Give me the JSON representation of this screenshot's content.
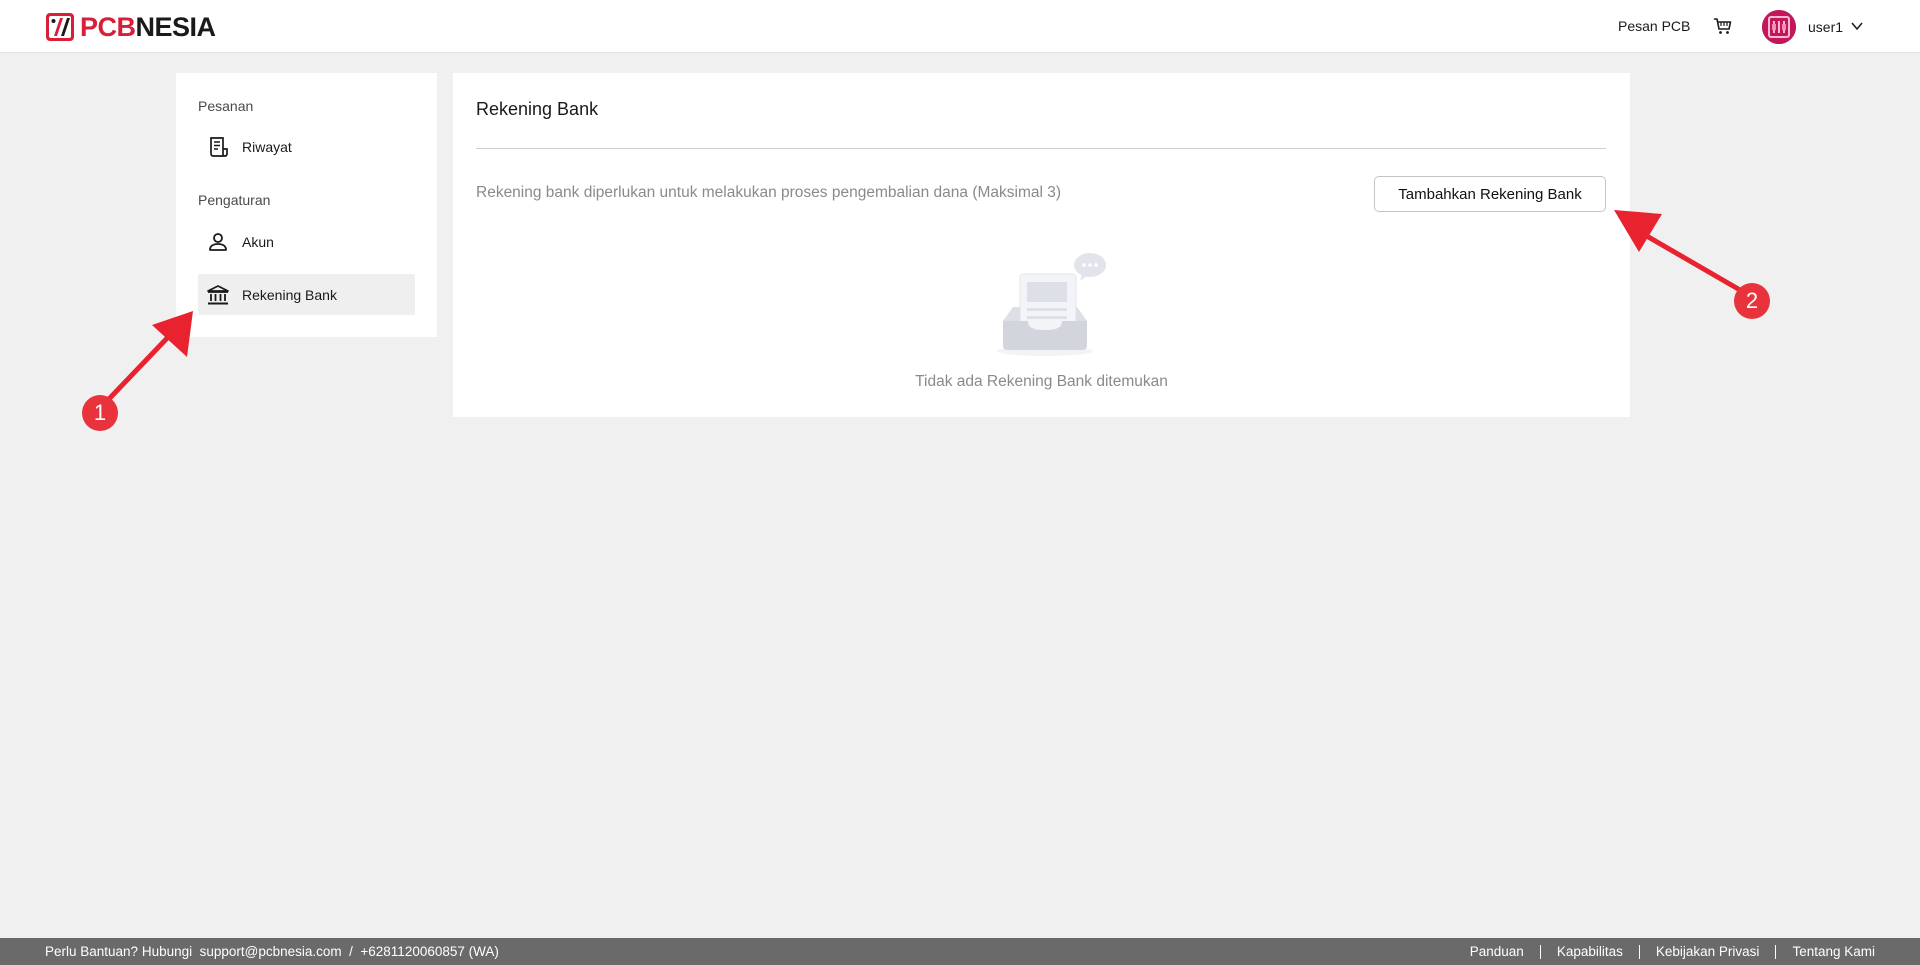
{
  "header": {
    "logo_text_red": "PCB",
    "logo_text_dark": "NESIA",
    "nav_order": "Pesan PCB",
    "user_name": "user1"
  },
  "sidebar": {
    "sections": [
      {
        "label": "Pesanan",
        "items": [
          {
            "label": "Riwayat",
            "icon": "receipt-icon"
          }
        ]
      },
      {
        "label": "Pengaturan",
        "items": [
          {
            "label": "Akun",
            "icon": "person-icon"
          },
          {
            "label": "Rekening Bank",
            "icon": "bank-icon",
            "active": true
          }
        ]
      }
    ]
  },
  "main": {
    "title": "Rekening Bank",
    "description": "Rekening bank diperlukan untuk melakukan proses pengembalian dana (Maksimal 3)",
    "add_button": "Tambahkan Rekening Bank",
    "empty_text": "Tidak ada Rekening Bank ditemukan"
  },
  "annotations": [
    {
      "number": "1",
      "target": "sidebar-item-rekening-bank"
    },
    {
      "number": "2",
      "target": "add-bank-account-button"
    }
  ],
  "footer": {
    "help_text": "Perlu Bantuan? Hubungi  support@pcbnesia.com  /  +6281120060857 (WA)",
    "links": [
      "Panduan",
      "Kapabilitas",
      "Kebijakan Privasi",
      "Tentang Kami"
    ]
  },
  "colors": {
    "brand_red": "#d81f3a",
    "annotation_red": "#e8333c",
    "footer_bg": "#6a6a6a"
  }
}
